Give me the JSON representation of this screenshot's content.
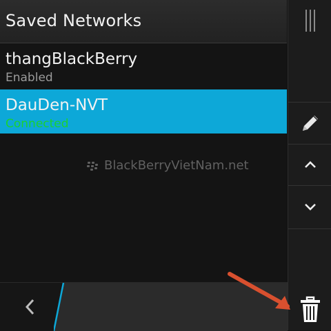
{
  "header": {
    "title": "Saved Networks"
  },
  "networks": [
    {
      "name": "thangBlackBerry",
      "status": "Enabled",
      "selected": false
    },
    {
      "name": "DauDen-NVT",
      "status": "Connected",
      "selected": true
    }
  ],
  "watermark": {
    "text": "BlackBerryVietNam.net"
  },
  "actionbar": {
    "items": [
      {
        "icon": "overflow-handle-icon"
      },
      {
        "icon": "pencil-icon"
      },
      {
        "icon": "chevron-up-icon"
      },
      {
        "icon": "chevron-down-icon"
      },
      {
        "icon": "trash-icon"
      }
    ]
  },
  "bottombar": {
    "icon": "chevron-left-icon"
  },
  "colors": {
    "accent": "#0da8d8",
    "connected": "#1bd131",
    "annotation_arrow": "#d8502f"
  }
}
